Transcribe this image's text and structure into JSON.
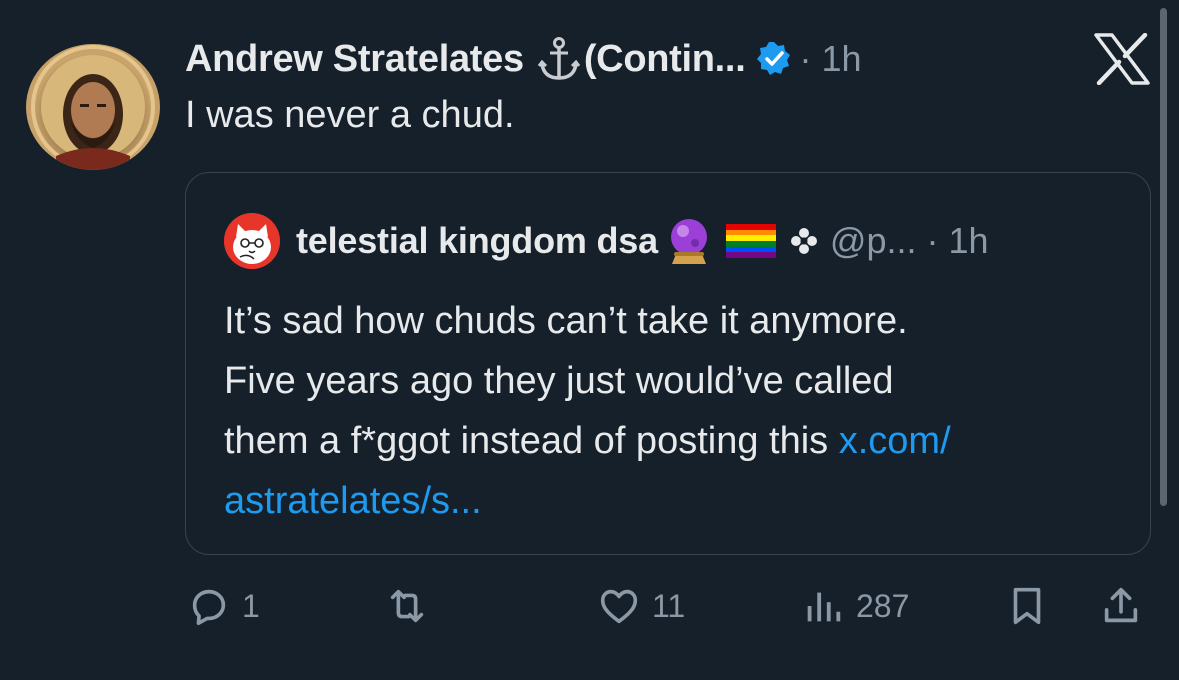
{
  "post": {
    "author_name": "Andrew Stratelates",
    "author_suffix": "(Contin...",
    "time_meta": "· 1h",
    "text": "I was never a chud.",
    "avatar_text": "Andrew Stratelates",
    "icons": [
      "anchor-icon",
      "verified-icon",
      "x-logo-icon"
    ]
  },
  "quote": {
    "author_name": "telestial kingdom dsa",
    "handle_meta": "@p... · 1h",
    "body_line1": "It’s sad how chuds can’t take it anymore.",
    "body_line2": "Five years ago they just would’ve called",
    "body_line3": "them a f*ggot instead of posting this ",
    "link_part1": "x.com/",
    "link_part2": "astratelates/s...",
    "icons": [
      "crystal-ball-icon",
      "rainbow-flag-icon",
      "flower-icon"
    ]
  },
  "actions": {
    "replies": "1",
    "reposts": "",
    "likes": "11",
    "views": "287"
  },
  "colors": {
    "background": "#15202b",
    "text": "#e7e9ea",
    "muted": "#8b98a5",
    "link": "#1d9bf0",
    "verified": "#1d9bf0",
    "border": "#38444d"
  }
}
